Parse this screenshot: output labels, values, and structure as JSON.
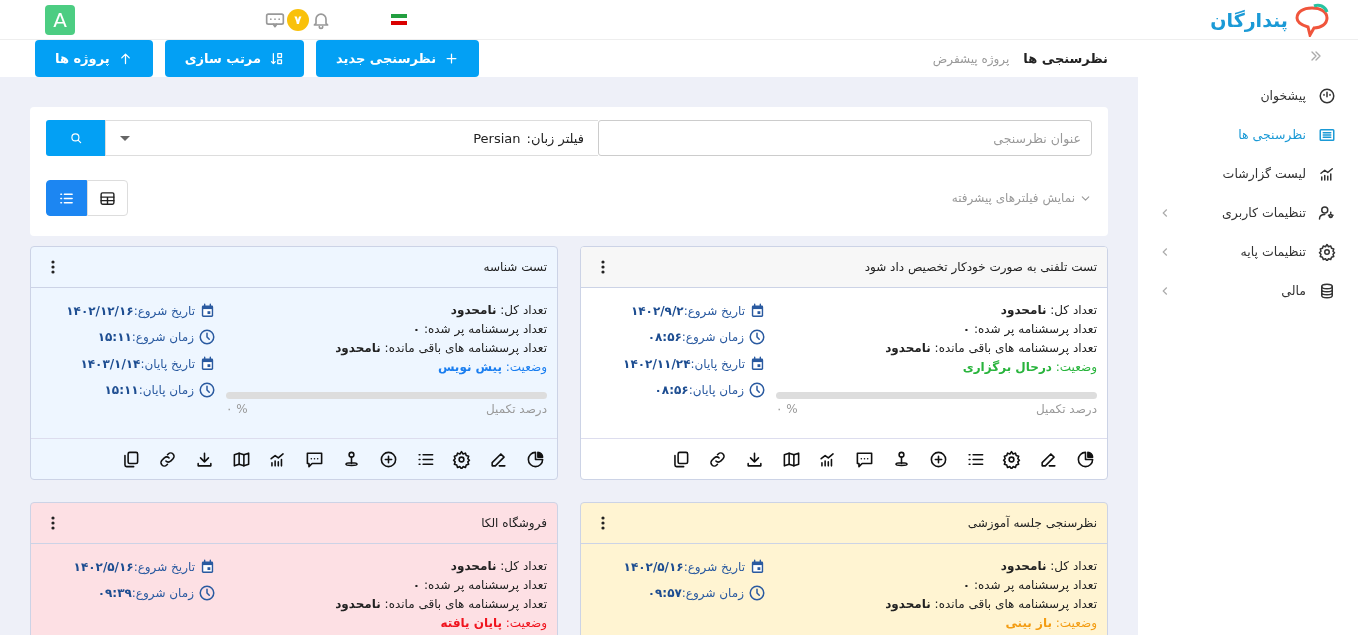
{
  "header": {
    "logo_text": "پندارگان",
    "notification_count": "۷",
    "avatar_letter": "A"
  },
  "sidebar": {
    "items": [
      {
        "label": "پیشخوان",
        "selected": false,
        "has_children": false
      },
      {
        "label": "نظرسنجی ها",
        "selected": true,
        "has_children": false
      },
      {
        "label": "لیست گزارشات",
        "selected": false,
        "has_children": false
      },
      {
        "label": "تنظیمات کاربری",
        "selected": false,
        "has_children": true
      },
      {
        "label": "تنظیمات پایه",
        "selected": false,
        "has_children": true
      },
      {
        "label": "مالی",
        "selected": false,
        "has_children": true
      }
    ]
  },
  "toolbar": {
    "title": "نظرسنجی ها",
    "subtitle": "پروژه پیشفرض",
    "buttons": [
      {
        "label": "نظرسنجی جدید"
      },
      {
        "label": "مرتب سازی"
      },
      {
        "label": "پروژه ها"
      }
    ]
  },
  "filters": {
    "search": {
      "placeholder": "عنوان نظرسنجی"
    },
    "language": {
      "label": "فیلتر زبان:",
      "value": "Persian"
    },
    "advanced_toggle": "نمایش فیلترهای پیشرفته",
    "views": [
      {
        "kind": "list",
        "selected": true
      },
      {
        "kind": "table",
        "selected": false
      }
    ]
  },
  "cards": [
    {
      "title": "تست تلفنی به صورت خودکار تخصیص داد شود",
      "color": "#ffffff",
      "stats": [
        "تعداد کل: **نامحدود**",
        "تعداد پرسشنامه پر شده: **۰**",
        "تعداد پرسشنامه های باقی مانده: **نامحدود**"
      ],
      "status": {
        "text": "وضعیت: **درحال برگزاری**",
        "color": "#28b43c"
      },
      "dates": [
        {
          "kind": "date",
          "text": "تاریخ شروع:**۱۴۰۲/۹/۲**"
        },
        {
          "kind": "time",
          "text": "زمان شروع:**۰۸:۵۶**"
        },
        {
          "kind": "date",
          "text": "تاریخ پایان:**۱۴۰۲/۱۱/۲۴**"
        },
        {
          "kind": "time",
          "text": "زمان پایان:**۰۸:۵۶**"
        }
      ],
      "progress": {
        "level": 0,
        "percent": "۰ %",
        "label": "درصد تکمیل"
      }
    },
    {
      "title": "تست شناسه",
      "color": "#eef6ff",
      "stats": [
        "تعداد کل: **نامحدود**",
        "تعداد پرسشنامه پر شده: **۰**",
        "تعداد پرسشنامه های باقی مانده: **نامحدود**"
      ],
      "status": {
        "text": "وضعیت: **پیش نویس**",
        "color": "#1a7ef0"
      },
      "dates": [
        {
          "kind": "date",
          "text": "تاریخ شروع:**۱۴۰۲/۱۲/۱۶**"
        },
        {
          "kind": "time",
          "text": "زمان شروع:**۱۵:۱۱**"
        },
        {
          "kind": "date",
          "text": "تاریخ پایان:**۱۴۰۳/۱/۱۴**"
        },
        {
          "kind": "time",
          "text": "زمان پایان:**۱۵:۱۱**"
        }
      ],
      "progress": {
        "level": 0,
        "percent": "۰ %",
        "label": "درصد تکمیل"
      }
    },
    {
      "title": "نظرسنجی جلسه آموزشی",
      "color": "#fff4d2",
      "stats": [
        "تعداد کل: **نامحدود**",
        "تعداد پرسشنامه پر شده: **۰**",
        "تعداد پرسشنامه های باقی مانده: **نامحدود**"
      ],
      "status": {
        "text": "وضعیت: **باز بینی**",
        "color": "#f39c12"
      },
      "dates": [
        {
          "kind": "date",
          "text": "تاریخ شروع:**۱۴۰۲/۵/۱۶**"
        },
        {
          "kind": "time",
          "text": "زمان شروع:**۰۹:۵۷**"
        }
      ]
    },
    {
      "title": "فروشگاه الکا",
      "color": "#fde0e4",
      "stats": [
        "تعداد کل: **نامحدود**",
        "تعداد پرسشنامه پر شده: **۰**",
        "تعداد پرسشنامه های باقی مانده: **نامحدود**"
      ],
      "status": {
        "text": "وضعیت: **پایان یافته**",
        "color": "#f0141e"
      },
      "dates": [
        {
          "kind": "date",
          "text": "تاریخ شروع:**۱۴۰۲/۵/۱۶**"
        },
        {
          "kind": "time",
          "text": "زمان شروع:**۰۹:۳۹**"
        }
      ]
    }
  ]
}
